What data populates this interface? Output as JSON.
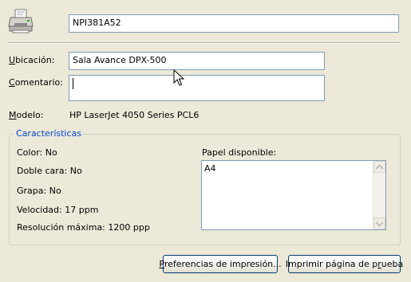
{
  "printer_name": "NPI381A52",
  "location": {
    "label_prefix": "U",
    "label_rest": "bicación:",
    "value": "Sala Avance DPX-500"
  },
  "comment": {
    "label_prefix": "C",
    "label_rest": "omentario:",
    "value": ""
  },
  "model": {
    "label_prefix": "M",
    "label_rest": "odelo:",
    "value": "HP LaserJet 4050 Series PCL6"
  },
  "features": {
    "title": "Características",
    "color": "Color: No",
    "duplex": "Doble cara: No",
    "staple": "Grapa: No",
    "speed": "Velocidad: 17 ppm",
    "resolution": "Resolución máxima: 1200 ppp",
    "paper_label": "Papel disponible:",
    "paper_items": [
      "A4"
    ]
  },
  "buttons": {
    "preferences_prefix": "P",
    "preferences_rest": "referencias de impresión...",
    "test_prefix": "Imprimir página de p",
    "test_underlined": "r",
    "test_rest": "ueba"
  },
  "icons": {
    "printer": "printer-icon",
    "pointer": "mouse-pointer-icon"
  }
}
